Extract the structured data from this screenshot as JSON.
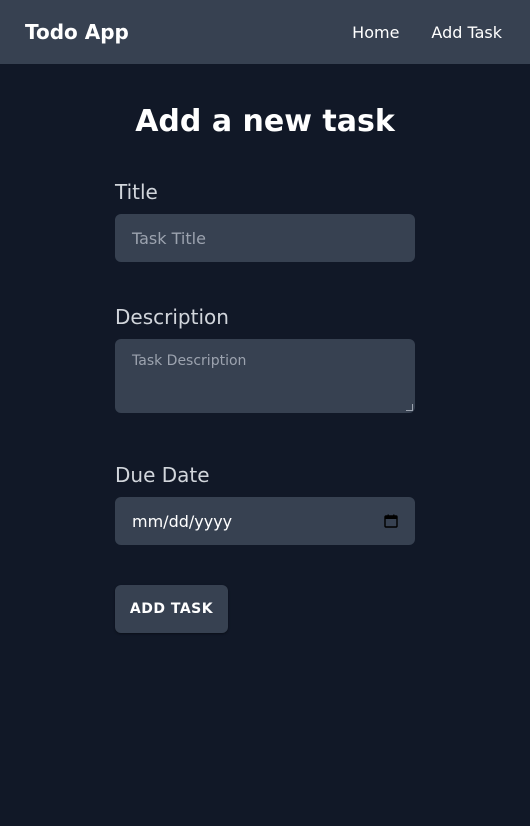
{
  "navbar": {
    "brand": "Todo App",
    "links": [
      "Home",
      "Add Task"
    ]
  },
  "page": {
    "title": "Add a new task"
  },
  "form": {
    "title": {
      "label": "Title",
      "placeholder": "Task Title",
      "value": ""
    },
    "description": {
      "label": "Description",
      "placeholder": "Task Description",
      "value": ""
    },
    "due_date": {
      "label": "Due Date",
      "display": "mm/dd/yyyy",
      "icon": "calendar-icon"
    },
    "submit_label": "ADD TASK"
  },
  "colors": {
    "background": "#111827",
    "navbar": "#374151",
    "input": "#374151",
    "label": "#d1d5db",
    "placeholder": "#9ca3af"
  }
}
